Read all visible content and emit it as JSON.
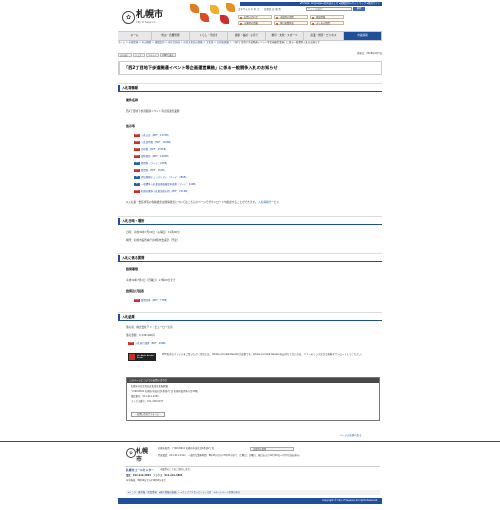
{
  "header": {
    "logo_text": "札幌市",
    "logo_sub": "City of Sapporo",
    "logo_mark": "✿",
    "top_links": "▸Foreign language  ▸音声読み上げ  ▸組織案内  ▸サイトマップ  ▸携帯サイト",
    "text_size_label": "文字サイズ 小 中 大",
    "color_label": "背景色 白 黒 青",
    "search_placeholder": "サイト内検索",
    "search_button": "検索",
    "quick_links": [
      "お問い合わせ",
      "市役所の場所",
      "施設情報",
      "災害時の情報",
      "休日夜間救急",
      "よくある質問"
    ]
  },
  "menu": {
    "items": [
      "ホーム",
      "防災・危機管理",
      "くらし・手続き",
      "健康・福祉・子育て",
      "教育・文化・スポーツ",
      "産業・経済・ビジネス",
      "市政情報"
    ],
    "active_index": 6
  },
  "breadcrumb": {
    "items": [
      "ホーム",
      "市政情報",
      "市の概要",
      "組織案内",
      "市民文化局",
      "市民文化局の組織",
      "文化部",
      "文化振興課",
      "「西2丁目地下歩道開通イベント等企画運営業務」に係る一般競争入札のお知らせ"
    ]
  },
  "share": {
    "buttons": [
      "いいね！",
      "シェア",
      "ツイート",
      "LINEで送る"
    ],
    "updated": "更新日：2018年6月5日"
  },
  "page_title": "「西2丁目地下歩道開通イベント等企画運営業務」に係る一般競争入札のお知らせ",
  "sections": {
    "bid_info": "入札等情報",
    "case_name_h": "案件名称",
    "case_name": "西2丁目地下歩道開通イベント等企画運営業務",
    "notice_h": "告示等",
    "docs": [
      "入札公告（PDF：137KB）",
      "入札説明書（PDF：193KB）",
      "仕様書（PDF：133KB）",
      "契約書案（PDF：140KB）",
      "質問書（ワード：22KB）",
      "質問書（PDF：11KB）",
      "提出書類チェックリスト（ワード：18KB）",
      "一般競争入札参加資格確認申請書（ワード：41KB）",
      "札幌市競争入札参加者心得（PDF：151KB）"
    ],
    "note": "※入札書・委任状等の各種書式は関係様式についてはこちらのページでダウンロードや確認することができます。",
    "note_link": "入札情報サービス",
    "schedule_h": "入札日時・場所",
    "schedule_1": "日時：平成30年7月10日（火曜日）11時00分",
    "schedule_2": "場所：札幌市役所本庁舎8階中会議室（予定）",
    "question_h": "入札に係る質問",
    "period_h": "質問期限",
    "period": "平成30年7月2日（月曜日）17時00分まで",
    "answer_h": "質問及び回答",
    "answer_doc": "質問回答（PDF：77KB）",
    "result_h": "入札結果",
    "result_1": "落札者：株式会社アド・ビューロー岩泉",
    "result_2": "落札金額：2,138,400円",
    "result_doc": "入札執行調書（PDF：49KB）"
  },
  "adobe": {
    "badge": "Get Adobe Acrobat Reader",
    "text": "PDF形式のファイルをご覧いただく場合には、Adobe Acrobat Readerが必要です。Adobe Acrobat Readerをお持ちでない方は、バナーのリンク先から無料ダウンロードしてください。"
  },
  "inquiry": {
    "header": "このページについてのお問い合わせ",
    "lines": [
      "札幌市市民文化局文化部文化振興課",
      "〒060-8611 札幌市中央区北1条西2丁目 札幌市役所本庁舎13階",
      "電話番号：011-211-2261",
      "ファクス番号：011-218-5157"
    ],
    "form_button": "お問い合わせフォーム"
  },
  "pagetop": "ページの先頭へ戻る",
  "footer": {
    "logo_text": "札幌市",
    "logo_mark": "✿",
    "address": "札幌市役所　〒060-8611 札幌市中央区北1条西2丁目",
    "tel": "代表電話：011-211-2111　一般的な業務時間：8時45分から17時15分まで（土曜日、日曜日、祝日および12月29日～1月3日はお休み）",
    "map_button": "市役所の場所",
    "call_title": "札幌市コールセンター",
    "call_desc": "市役所のことをご案内します。",
    "call_tel": "電話：011-222-4894　ファクス：011-221-4894",
    "call_hours": "年中無休、8時00分から21時00分まで",
    "nav": "▸リンク・著作権・免責事項　▸個人情報の取扱い　▸ウェブアクセシビリティ方針　▸ホームページ全体の見方",
    "copyright": "Copyright © City of Sapporo All rights Reserved."
  },
  "colors": {
    "primary": "#1f4f9b",
    "link": "#1a4aa0",
    "pdf": "#c9302c"
  }
}
